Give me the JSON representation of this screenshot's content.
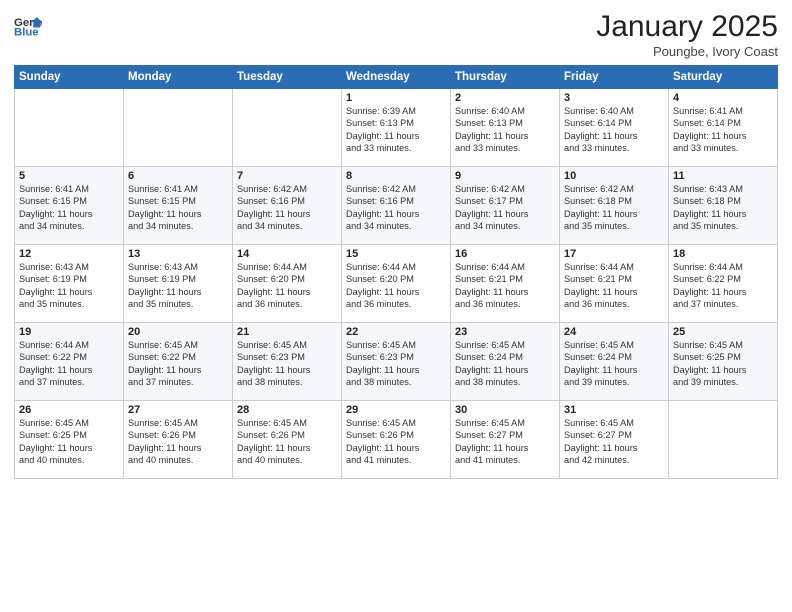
{
  "logo": {
    "general": "General",
    "blue": "Blue"
  },
  "title": "January 2025",
  "location": "Poungbe, Ivory Coast",
  "days_of_week": [
    "Sunday",
    "Monday",
    "Tuesday",
    "Wednesday",
    "Thursday",
    "Friday",
    "Saturday"
  ],
  "weeks": [
    [
      {
        "day": "",
        "info": ""
      },
      {
        "day": "",
        "info": ""
      },
      {
        "day": "",
        "info": ""
      },
      {
        "day": "1",
        "info": "Sunrise: 6:39 AM\nSunset: 6:13 PM\nDaylight: 11 hours\nand 33 minutes."
      },
      {
        "day": "2",
        "info": "Sunrise: 6:40 AM\nSunset: 6:13 PM\nDaylight: 11 hours\nand 33 minutes."
      },
      {
        "day": "3",
        "info": "Sunrise: 6:40 AM\nSunset: 6:14 PM\nDaylight: 11 hours\nand 33 minutes."
      },
      {
        "day": "4",
        "info": "Sunrise: 6:41 AM\nSunset: 6:14 PM\nDaylight: 11 hours\nand 33 minutes."
      }
    ],
    [
      {
        "day": "5",
        "info": "Sunrise: 6:41 AM\nSunset: 6:15 PM\nDaylight: 11 hours\nand 34 minutes."
      },
      {
        "day": "6",
        "info": "Sunrise: 6:41 AM\nSunset: 6:15 PM\nDaylight: 11 hours\nand 34 minutes."
      },
      {
        "day": "7",
        "info": "Sunrise: 6:42 AM\nSunset: 6:16 PM\nDaylight: 11 hours\nand 34 minutes."
      },
      {
        "day": "8",
        "info": "Sunrise: 6:42 AM\nSunset: 6:16 PM\nDaylight: 11 hours\nand 34 minutes."
      },
      {
        "day": "9",
        "info": "Sunrise: 6:42 AM\nSunset: 6:17 PM\nDaylight: 11 hours\nand 34 minutes."
      },
      {
        "day": "10",
        "info": "Sunrise: 6:42 AM\nSunset: 6:18 PM\nDaylight: 11 hours\nand 35 minutes."
      },
      {
        "day": "11",
        "info": "Sunrise: 6:43 AM\nSunset: 6:18 PM\nDaylight: 11 hours\nand 35 minutes."
      }
    ],
    [
      {
        "day": "12",
        "info": "Sunrise: 6:43 AM\nSunset: 6:19 PM\nDaylight: 11 hours\nand 35 minutes."
      },
      {
        "day": "13",
        "info": "Sunrise: 6:43 AM\nSunset: 6:19 PM\nDaylight: 11 hours\nand 35 minutes."
      },
      {
        "day": "14",
        "info": "Sunrise: 6:44 AM\nSunset: 6:20 PM\nDaylight: 11 hours\nand 36 minutes."
      },
      {
        "day": "15",
        "info": "Sunrise: 6:44 AM\nSunset: 6:20 PM\nDaylight: 11 hours\nand 36 minutes."
      },
      {
        "day": "16",
        "info": "Sunrise: 6:44 AM\nSunset: 6:21 PM\nDaylight: 11 hours\nand 36 minutes."
      },
      {
        "day": "17",
        "info": "Sunrise: 6:44 AM\nSunset: 6:21 PM\nDaylight: 11 hours\nand 36 minutes."
      },
      {
        "day": "18",
        "info": "Sunrise: 6:44 AM\nSunset: 6:22 PM\nDaylight: 11 hours\nand 37 minutes."
      }
    ],
    [
      {
        "day": "19",
        "info": "Sunrise: 6:44 AM\nSunset: 6:22 PM\nDaylight: 11 hours\nand 37 minutes."
      },
      {
        "day": "20",
        "info": "Sunrise: 6:45 AM\nSunset: 6:22 PM\nDaylight: 11 hours\nand 37 minutes."
      },
      {
        "day": "21",
        "info": "Sunrise: 6:45 AM\nSunset: 6:23 PM\nDaylight: 11 hours\nand 38 minutes."
      },
      {
        "day": "22",
        "info": "Sunrise: 6:45 AM\nSunset: 6:23 PM\nDaylight: 11 hours\nand 38 minutes."
      },
      {
        "day": "23",
        "info": "Sunrise: 6:45 AM\nSunset: 6:24 PM\nDaylight: 11 hours\nand 38 minutes."
      },
      {
        "day": "24",
        "info": "Sunrise: 6:45 AM\nSunset: 6:24 PM\nDaylight: 11 hours\nand 39 minutes."
      },
      {
        "day": "25",
        "info": "Sunrise: 6:45 AM\nSunset: 6:25 PM\nDaylight: 11 hours\nand 39 minutes."
      }
    ],
    [
      {
        "day": "26",
        "info": "Sunrise: 6:45 AM\nSunset: 6:25 PM\nDaylight: 11 hours\nand 40 minutes."
      },
      {
        "day": "27",
        "info": "Sunrise: 6:45 AM\nSunset: 6:26 PM\nDaylight: 11 hours\nand 40 minutes."
      },
      {
        "day": "28",
        "info": "Sunrise: 6:45 AM\nSunset: 6:26 PM\nDaylight: 11 hours\nand 40 minutes."
      },
      {
        "day": "29",
        "info": "Sunrise: 6:45 AM\nSunset: 6:26 PM\nDaylight: 11 hours\nand 41 minutes."
      },
      {
        "day": "30",
        "info": "Sunrise: 6:45 AM\nSunset: 6:27 PM\nDaylight: 11 hours\nand 41 minutes."
      },
      {
        "day": "31",
        "info": "Sunrise: 6:45 AM\nSunset: 6:27 PM\nDaylight: 11 hours\nand 42 minutes."
      },
      {
        "day": "",
        "info": ""
      }
    ]
  ]
}
